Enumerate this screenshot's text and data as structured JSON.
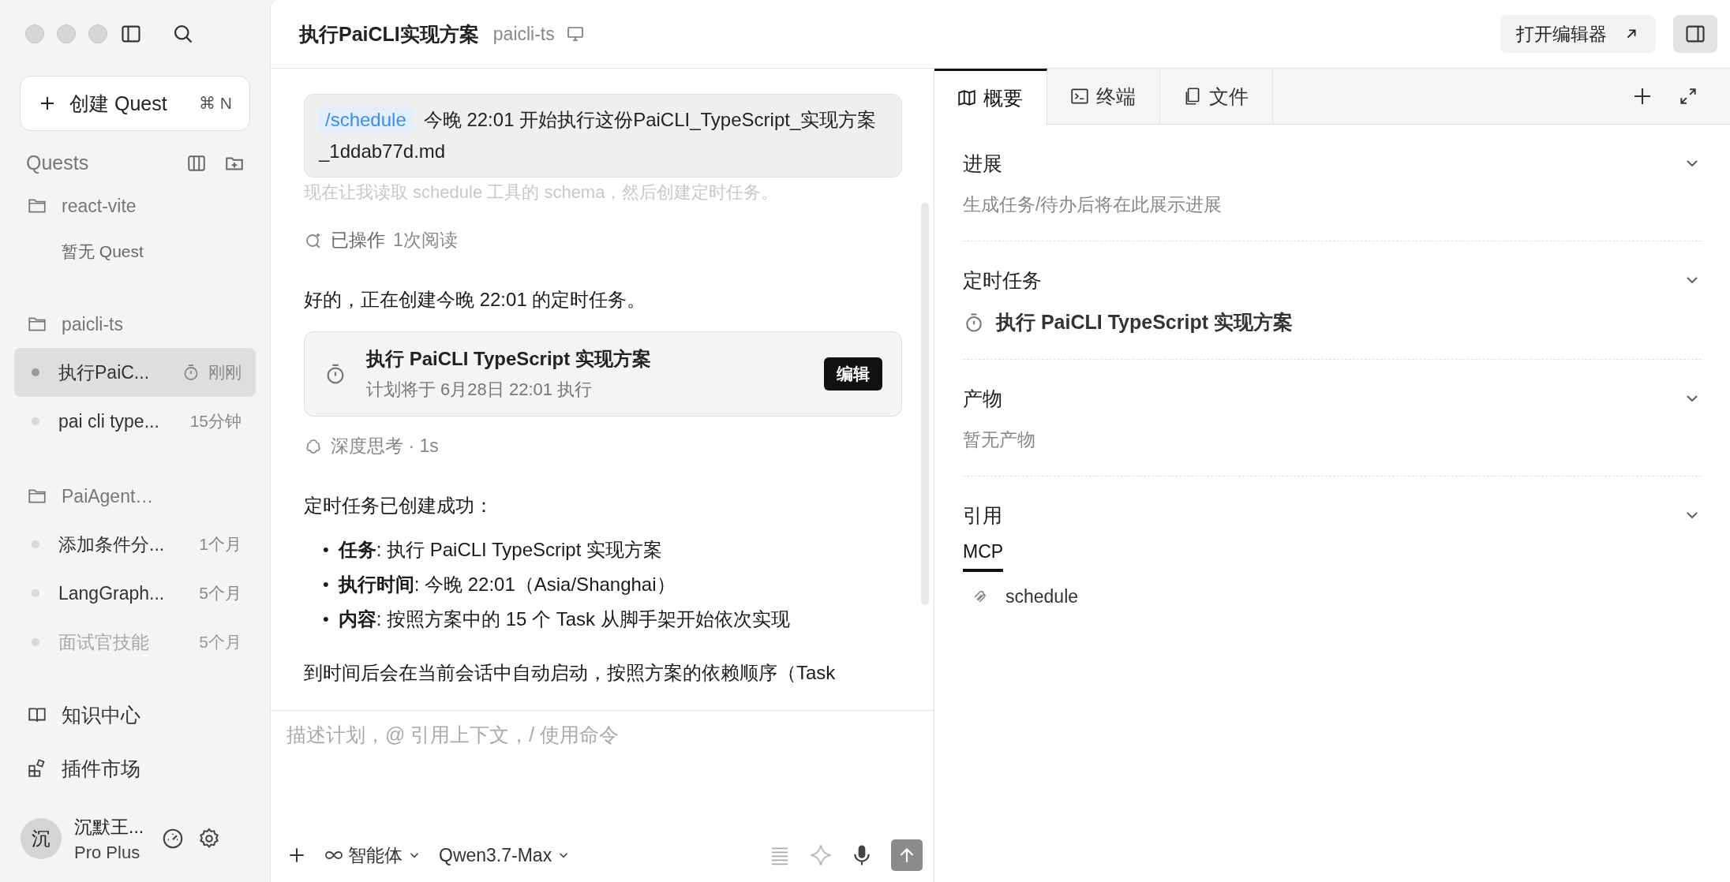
{
  "sidebar": {
    "new_button": {
      "label": "创建 Quest",
      "shortcut": "⌘ N"
    },
    "section_title": "Quests",
    "groups": [
      {
        "name": "react-vite",
        "empty_text": "暂无 Quest"
      },
      {
        "name": "paicli-ts",
        "items": [
          {
            "title": "执行PaiC...",
            "time": "刚刚",
            "selected": true,
            "scheduled": true,
            "faded": false
          },
          {
            "title": "pai cli type...",
            "time": "15分钟",
            "selected": false,
            "scheduled": false,
            "faded": false
          }
        ]
      },
      {
        "name": "PaiAgent…",
        "items": [
          {
            "title": "添加条件分...",
            "time": "1个月",
            "selected": false,
            "scheduled": false,
            "faded": false
          },
          {
            "title": "LangGraph...",
            "time": "5个月",
            "selected": false,
            "scheduled": false,
            "faded": false
          },
          {
            "title": "面试官技能",
            "time": "5个月",
            "selected": false,
            "scheduled": false,
            "faded": true
          }
        ]
      }
    ],
    "links": [
      {
        "kind": "book",
        "label": "知识中心"
      },
      {
        "kind": "plugin",
        "label": "插件市场"
      }
    ],
    "user": {
      "avatar": "沉",
      "name": "沉默王...",
      "plan": "Pro Plus"
    }
  },
  "header": {
    "title": "执行PaiCLI实现方案",
    "project": "paicli-ts",
    "open_editor": "打开编辑器"
  },
  "chat": {
    "messages": [
      {
        "kind": "user",
        "command": "/schedule",
        "text": "今晚 22:01 开始执行这份PaiCLI_TypeScript_实现方案_1ddab77d.md"
      },
      {
        "kind": "faded",
        "text": "现在让我读取 schedule 工具的 schema，然后创建定时任务。"
      },
      {
        "kind": "status",
        "label": "已操作",
        "detail": "1次阅读"
      },
      {
        "kind": "text",
        "text": "好的，正在创建今晚 22:01 的定时任务。"
      },
      {
        "kind": "task",
        "title": "执行 PaiCLI TypeScript 实现方案",
        "subtitle": "计划将于 6月28日 22:01 执行",
        "button": "编辑"
      },
      {
        "kind": "thinking",
        "label": "深度思考 · 1s"
      },
      {
        "kind": "text",
        "text": "定时任务已创建成功："
      },
      {
        "kind": "bullets",
        "marker": "•",
        "items": [
          "**任务**: 执行 PaiCLI TypeScript 实现方案",
          "**执行时间**: 今晚 22:01（Asia/Shanghai）",
          "**内容**: 按照方案中的 15 个 Task 从脚手架开始依次实现"
        ]
      },
      {
        "kind": "text",
        "text": "到时间后会在当前会话中自动启动，按照方案的依赖顺序（Task"
      }
    ],
    "input": {
      "placeholder": "描述计划，@ 引用上下文，/ 使用命令",
      "mode": "智能体",
      "model": "Qwen3.7-Max"
    }
  },
  "panel": {
    "tabs": [
      {
        "kind": "map",
        "label": "概要",
        "selected": true
      },
      {
        "kind": "terminal",
        "label": "终端",
        "selected": false
      },
      {
        "kind": "files",
        "label": "文件",
        "selected": false
      }
    ],
    "sections": [
      {
        "kind": "empty",
        "title": "进展",
        "text": "生成任务/待办后将在此展示进展"
      },
      {
        "kind": "task",
        "title": "定时任务",
        "text": "执行 PaiCLI TypeScript 实现方案"
      },
      {
        "kind": "empty",
        "title": "产物",
        "text": "暂无产物"
      },
      {
        "kind": "refs",
        "title": "引用",
        "tabs": [
          {
            "label": "MCP",
            "selected": true
          }
        ],
        "items": [
          "schedule"
        ]
      }
    ]
  }
}
